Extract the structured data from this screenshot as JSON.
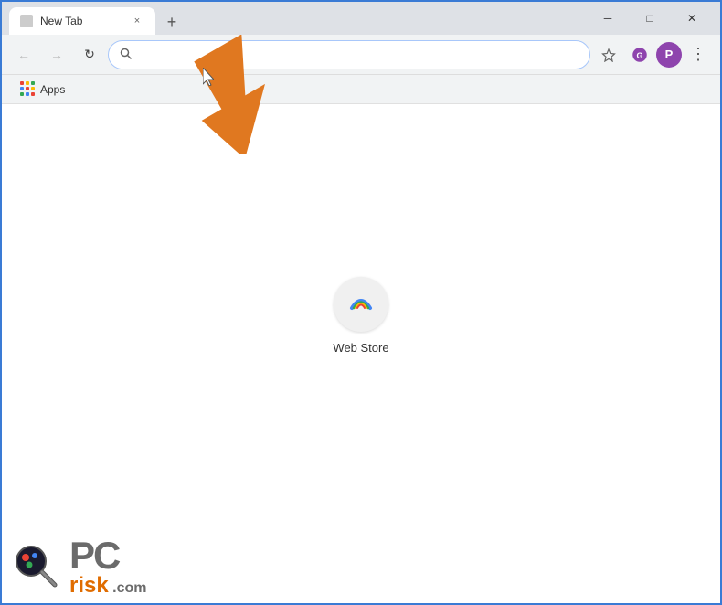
{
  "titleBar": {
    "tab": {
      "title": "New Tab",
      "close_label": "×"
    },
    "newTabButton": "+",
    "windowControls": {
      "minimize": "─",
      "maximize": "□",
      "close": "✕"
    }
  },
  "navBar": {
    "backButton": "←",
    "forwardButton": "→",
    "refreshButton": "↻",
    "addressBar": {
      "placeholder": "",
      "value": ""
    },
    "starLabel": "☆",
    "extensionLabel": "◉",
    "moreLabel": "⋮"
  },
  "bookmarksBar": {
    "appsLabel": "Apps"
  },
  "content": {
    "webStore": {
      "label": "Web Store"
    }
  },
  "watermark": {
    "pc": "PC",
    "risk": "risk",
    "com": ".com"
  },
  "colors": {
    "orange": "#e07820",
    "arrowOrange": "#e07820",
    "avatarBg": "#8e44ad",
    "accentBlue": "#3a7bd5"
  }
}
